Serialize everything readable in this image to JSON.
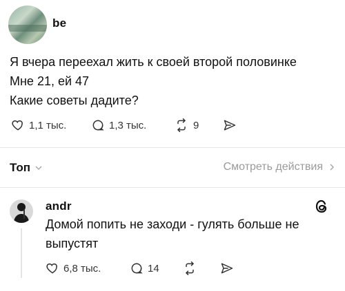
{
  "post": {
    "username": "be",
    "lines": [
      "Я вчера переехал жить к своей второй половинке",
      "Мне 21, ей 47",
      "Какие советы дадите?"
    ],
    "likes": "1,1 тыс.",
    "comments": "1,3 тыс.",
    "reposts": "9"
  },
  "bar": {
    "sort_label": "Топ",
    "view_actions": "Смотреть действия"
  },
  "reply": {
    "username": "andr",
    "lines": [
      "Домой попить не заходи - гулять больше не",
      "выпустят"
    ],
    "likes": "6,8 тыс.",
    "comments": "14"
  }
}
